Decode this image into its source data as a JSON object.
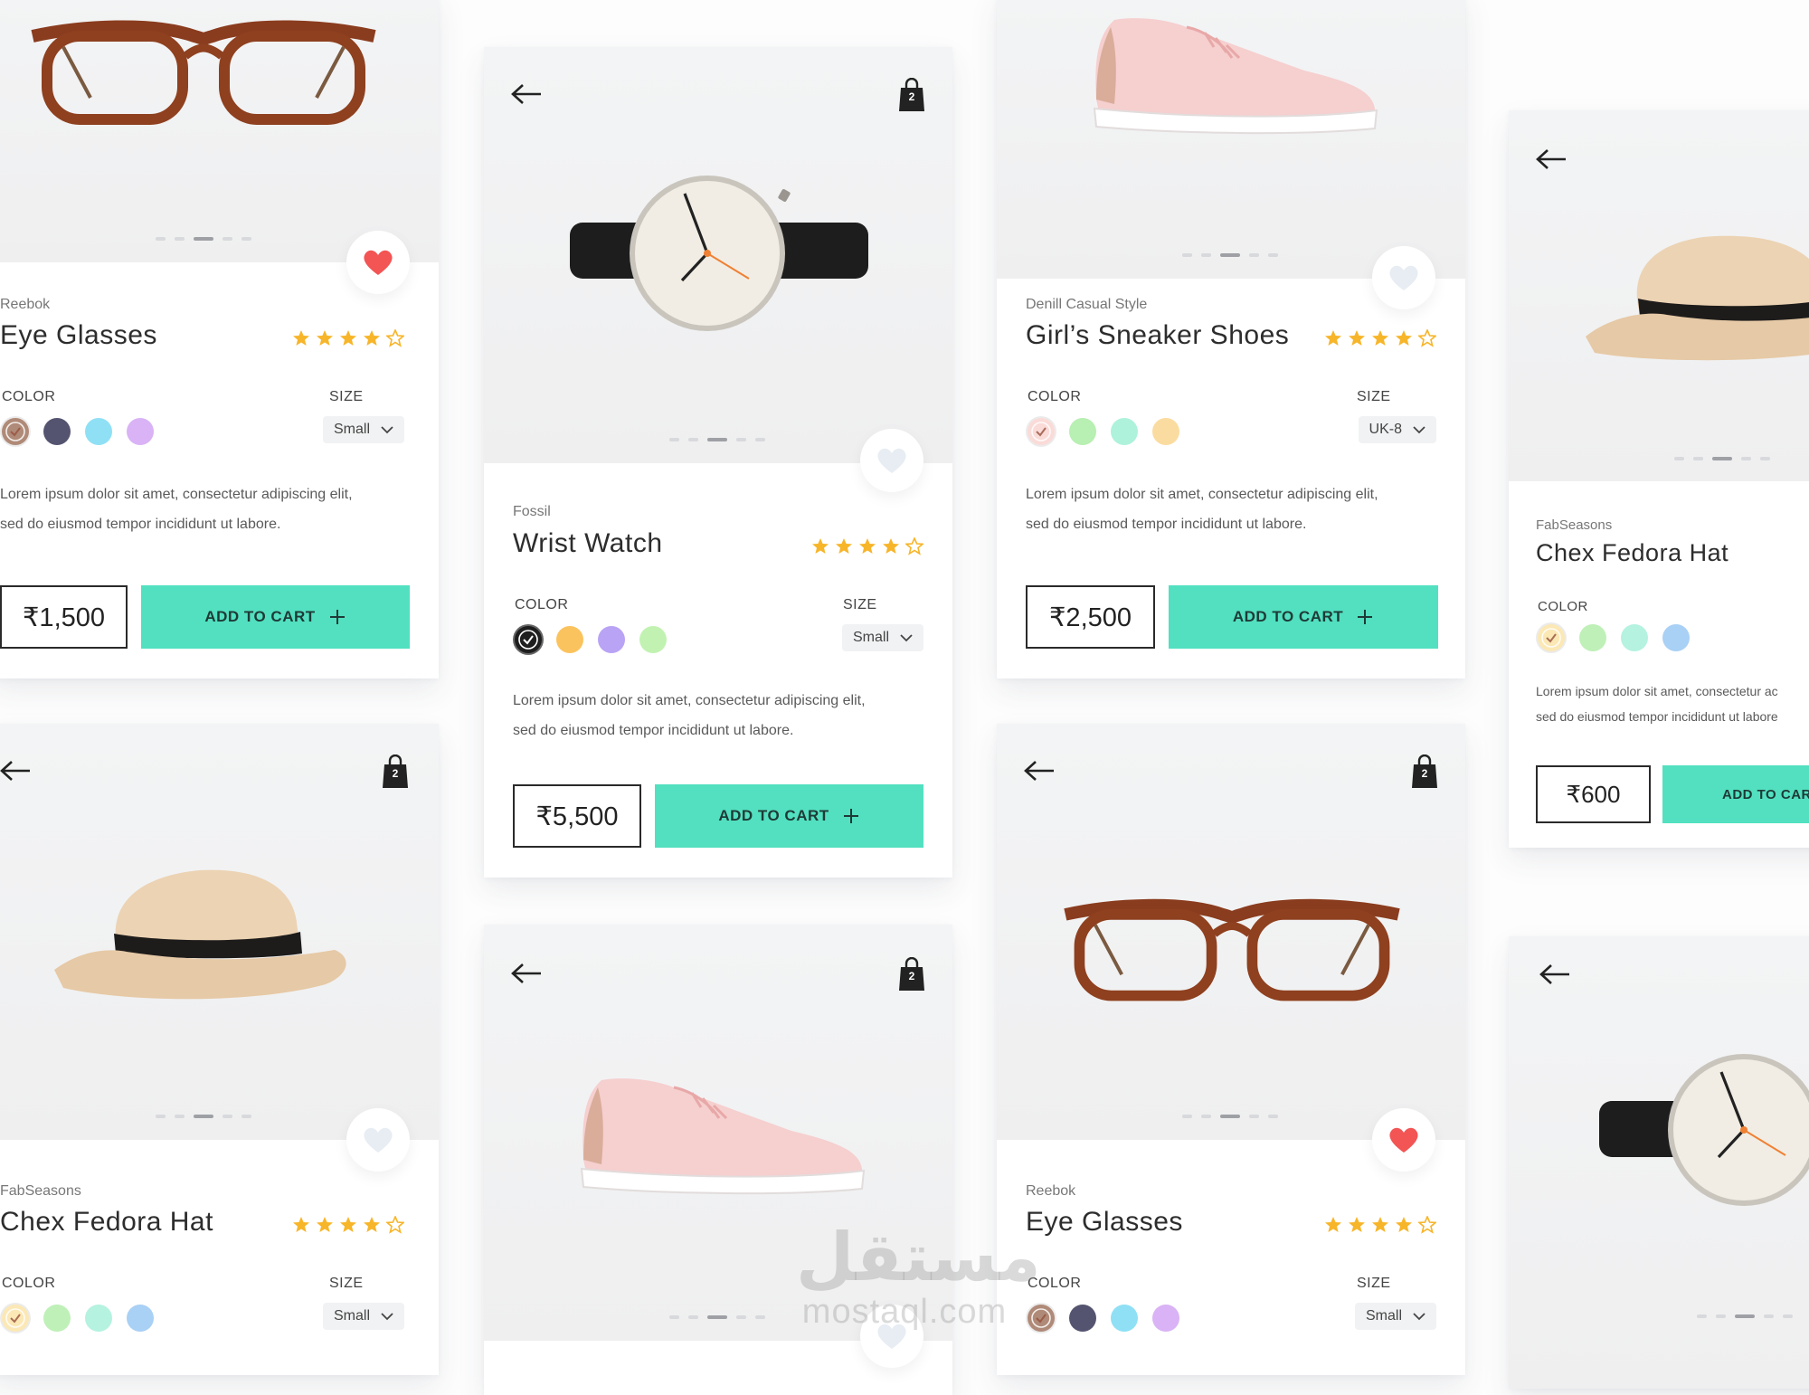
{
  "common": {
    "color_label": "COLOR",
    "size_label": "SIZE",
    "bag_count": "2"
  },
  "cards": [
    {
      "brand": "Reebok",
      "name": "Eye Glasses",
      "size": "Small",
      "desc_line1": "Lorem ipsum dolor sit amet, consectetur adipiscing elit,",
      "desc_line2": "sed do eiusmod tempor incididunt ut labore.",
      "price": "₹1,500",
      "cart_label": "ADD TO CART",
      "rating": 4,
      "favorited": true,
      "colors": [
        "#b08a78",
        "#545470",
        "#8fe0f5",
        "#d9b3f5"
      ]
    },
    {
      "brand": "Fossil",
      "name": "Wrist Watch",
      "size": "Small",
      "desc_line1": "Lorem ipsum dolor sit amet, consectetur adipiscing elit,",
      "desc_line2": "sed do eiusmod tempor incididunt ut labore.",
      "price": "₹5,500",
      "cart_label": "ADD TO CART",
      "rating": 4,
      "favorited": false,
      "colors": [
        "#1e1e1e",
        "#fbc35e",
        "#b9a3f5",
        "#c2f2b2"
      ]
    },
    {
      "brand": "Denill Casual Style",
      "name": "Girl’s Sneaker Shoes",
      "size": "UK-8",
      "desc_line1": "Lorem ipsum dolor sit amet, consectetur adipiscing elit,",
      "desc_line2": "sed do eiusmod tempor incididunt ut labore.",
      "price": "₹2,500",
      "cart_label": "ADD TO CART",
      "rating": 4,
      "favorited": false,
      "colors": [
        "#fadbd8",
        "#b8efb2",
        "#aef2dc",
        "#fbdca0"
      ]
    },
    {
      "brand": "FabSeasons",
      "name": "Chex Fedora Hat",
      "desc_line1": "Lorem ipsum dolor sit amet, consectetur ac",
      "desc_line2": "sed do eiusmod tempor incididunt ut labore",
      "price": "₹600",
      "cart_label": "ADD TO CART",
      "colors": [
        "#fbe8b5",
        "#bff0b8",
        "#b5f2e0",
        "#a9d0f5"
      ]
    },
    {
      "brand": "FabSeasons",
      "name": "Chex Fedora Hat",
      "size": "Small",
      "rating": 4,
      "favorited": false,
      "colors": [
        "#fbe8b5",
        "#bff0b8",
        "#b5f2e0",
        "#a9d0f5"
      ]
    },
    {
      "brand": "Reebok",
      "name": "Eye Glasses",
      "size": "Small",
      "rating": 4,
      "favorited": true,
      "colors": [
        "#b08a78",
        "#545470",
        "#8fe0f5",
        "#d9b3f5"
      ]
    }
  ],
  "watermark": {
    "arabic": "مستقل",
    "latin": "mostaql.com"
  }
}
